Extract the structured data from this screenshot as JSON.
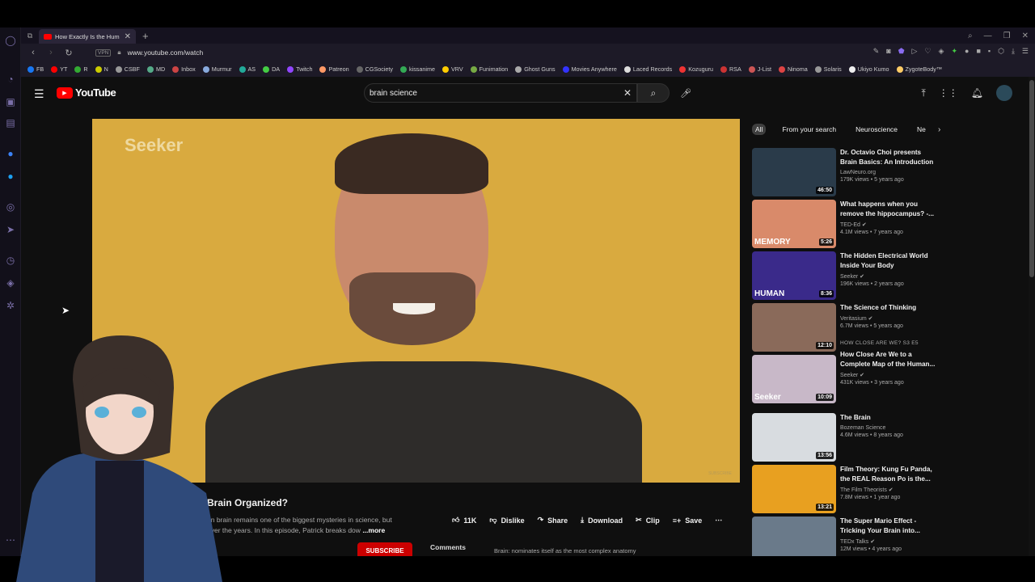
{
  "browser": {
    "tab_title": "How Exactly Is the Hum",
    "url": "www.youtube.com/watch",
    "vpn_label": "VPN",
    "new_tab": "+",
    "close_tab": "✕"
  },
  "bookmarks": [
    "FB",
    "YT",
    "R",
    "N",
    "CSBF",
    "MD",
    "Inbox",
    "Murmur",
    "AS",
    "DA",
    "Twitch",
    "Patreon",
    "CGSociety",
    "kissanime",
    "VRV",
    "Funimation",
    "Ghost Guns",
    "Movies Anywhere",
    "Laced Records",
    "Kozuguru",
    "RSA",
    "J-List",
    "Ninoma",
    "Solaris",
    "Ukiyo Kumo",
    "ZygoteBody™"
  ],
  "bookmark_colors": [
    "#1877f2",
    "#f00",
    "#3a3",
    "#cc0",
    "#999",
    "#5a8",
    "#c44",
    "#8ad",
    "#2a9",
    "#4c4",
    "#9146ff",
    "#f96",
    "#666",
    "#3a5",
    "#fc0",
    "#7a4",
    "#aaa",
    "#33f",
    "#ddd",
    "#e33",
    "#c33",
    "#c55",
    "#d44",
    "#999",
    "#eee",
    "#fc6"
  ],
  "youtube": {
    "logo_text": "YouTube",
    "search_value": "brain science",
    "video": {
      "watermark": "Seeker",
      "title": "Brain Organized?",
      "desc_line1": "an brain remains one of the biggest mysteries in science, but",
      "desc_line2": "over the years. In this episode, Patrick breaks dow",
      "more": "...more",
      "likes": "11K",
      "dislike": "Dislike",
      "share": "Share",
      "download": "Download",
      "clip": "Clip",
      "save": "Save",
      "subscribe": "SUBSCRIBE",
      "comments": "Comments",
      "comment_preview": "Brain: nominates itself as the most complex anatomy",
      "corner_text": "SUBSCRIBE"
    },
    "chips": [
      "All",
      "From your search",
      "Neuroscience",
      "Ne"
    ],
    "recommendations": [
      {
        "title": "Dr. Octavio Choi presents Brain Basics: An Introduction to...",
        "channel": "LawNeuro.org",
        "meta": "179K views • 5 years ago",
        "duration": "46:50",
        "color": "#2a3b4a",
        "label": "",
        "caption": ""
      },
      {
        "title": "What happens when you remove the hippocampus? -...",
        "channel": "TED-Ed ✔",
        "meta": "4.1M views • 7 years ago",
        "duration": "5:26",
        "color": "#d98a6a",
        "label": "",
        "caption": "MEMORY"
      },
      {
        "title": "The Hidden Electrical World Inside Your Body",
        "channel": "Seeker ✔",
        "meta": "196K views • 2 years ago",
        "duration": "8:36",
        "color": "#3a2a8a",
        "label": "",
        "caption": "HUMAN"
      },
      {
        "title": "The Science of Thinking",
        "channel": "Veritasium ✔",
        "meta": "6.7M views • 5 years ago",
        "duration": "12:10",
        "color": "#8a6a5a",
        "label": "",
        "caption": ""
      },
      {
        "title": "How Close Are We to a Complete Map of the Human...",
        "channel": "Seeker ✔",
        "meta": "431K views • 3 years ago",
        "duration": "10:09",
        "color": "#c8b8c8",
        "label": "HOW CLOSE ARE WE?  S3 E5",
        "caption": "Seeker"
      },
      {
        "title": "The Brain",
        "channel": "Bozeman Science",
        "meta": "4.6M views • 8 years ago",
        "duration": "13:56",
        "color": "#d8dce0",
        "label": "",
        "caption": ""
      },
      {
        "title": "Film Theory: Kung Fu Panda, the REAL Reason Po is the...",
        "channel": "The Film Theorists ✔",
        "meta": "7.8M views • 1 year ago",
        "duration": "13:21",
        "color": "#e8a020",
        "label": "",
        "caption": ""
      },
      {
        "title": "The Super Mario Effect - Tricking Your Brain into...",
        "channel": "TEDx Talks ✔",
        "meta": "12M views • 4 years ago",
        "duration": "",
        "color": "#6a7a8a",
        "label": "",
        "caption": ""
      }
    ]
  }
}
